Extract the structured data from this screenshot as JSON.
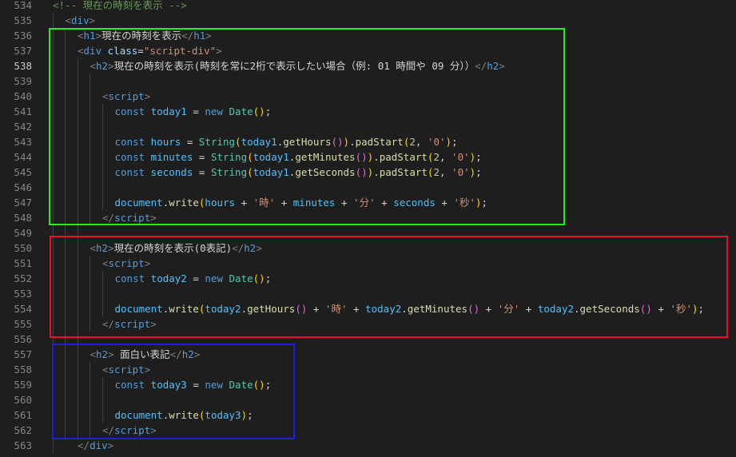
{
  "editor": {
    "active_line": "538",
    "highlight_colors": {
      "green_box": "#22ee22",
      "red_box": "#e8112d",
      "blue_box": "#1d1de0"
    },
    "lines": [
      {
        "n": "534",
        "indent": 0,
        "tokens": [
          [
            "cmt",
            "<!-- 現在の時刻を表示 -->"
          ]
        ]
      },
      {
        "n": "535",
        "indent": 1,
        "tokens": [
          [
            "br",
            "<"
          ],
          [
            "tag",
            "div"
          ],
          [
            "br",
            ">"
          ]
        ]
      },
      {
        "n": "536",
        "indent": 2,
        "tokens": [
          [
            "br",
            "<"
          ],
          [
            "tag",
            "h1"
          ],
          [
            "br",
            ">"
          ],
          [
            "txt",
            "現在の時刻を表示"
          ],
          [
            "br",
            "</"
          ],
          [
            "tag",
            "h1"
          ],
          [
            "br",
            ">"
          ]
        ]
      },
      {
        "n": "537",
        "indent": 2,
        "tokens": [
          [
            "br",
            "<"
          ],
          [
            "tag",
            "div"
          ],
          [
            "txt",
            " "
          ],
          [
            "attr",
            "class"
          ],
          [
            "op",
            "="
          ],
          [
            "str",
            "\"script-div\""
          ],
          [
            "br",
            ">"
          ]
        ]
      },
      {
        "n": "538",
        "indent": 3,
        "tokens": [
          [
            "br",
            "<"
          ],
          [
            "tag",
            "h2"
          ],
          [
            "br",
            ">"
          ],
          [
            "txt",
            "現在の時刻を表示(時刻を常に2桁で表示したい場合（例: 01 時間や 09 分））"
          ],
          [
            "br",
            "</"
          ],
          [
            "tag",
            "h2"
          ],
          [
            "br",
            ">"
          ]
        ]
      },
      {
        "n": "539",
        "indent": 0,
        "tokens": []
      },
      {
        "n": "540",
        "indent": 4,
        "tokens": [
          [
            "br",
            "<"
          ],
          [
            "tag",
            "script"
          ],
          [
            "br",
            ">"
          ]
        ]
      },
      {
        "n": "541",
        "indent": 5,
        "tokens": [
          [
            "kw",
            "const"
          ],
          [
            "txt",
            " "
          ],
          [
            "var",
            "today1"
          ],
          [
            "op",
            " = "
          ],
          [
            "kw",
            "new"
          ],
          [
            "txt",
            " "
          ],
          [
            "cls",
            "Date"
          ],
          [
            "p1",
            "()"
          ],
          [
            "op",
            ";"
          ]
        ]
      },
      {
        "n": "542",
        "indent": 0,
        "tokens": []
      },
      {
        "n": "543",
        "indent": 5,
        "tokens": [
          [
            "kw",
            "const"
          ],
          [
            "txt",
            " "
          ],
          [
            "var",
            "hours"
          ],
          [
            "op",
            " = "
          ],
          [
            "cls",
            "String"
          ],
          [
            "p1",
            "("
          ],
          [
            "var",
            "today1"
          ],
          [
            "op",
            "."
          ],
          [
            "fn",
            "getHours"
          ],
          [
            "p2",
            "()"
          ],
          [
            "p1",
            ")"
          ],
          [
            "op",
            "."
          ],
          [
            "fn",
            "padStart"
          ],
          [
            "p1",
            "("
          ],
          [
            "num",
            "2"
          ],
          [
            "op",
            ", "
          ],
          [
            "str",
            "'0'"
          ],
          [
            "p1",
            ")"
          ],
          [
            "op",
            ";"
          ]
        ]
      },
      {
        "n": "544",
        "indent": 5,
        "tokens": [
          [
            "kw",
            "const"
          ],
          [
            "txt",
            " "
          ],
          [
            "var",
            "minutes"
          ],
          [
            "op",
            " = "
          ],
          [
            "cls",
            "String"
          ],
          [
            "p1",
            "("
          ],
          [
            "var",
            "today1"
          ],
          [
            "op",
            "."
          ],
          [
            "fn",
            "getMinutes"
          ],
          [
            "p2",
            "()"
          ],
          [
            "p1",
            ")"
          ],
          [
            "op",
            "."
          ],
          [
            "fn",
            "padStart"
          ],
          [
            "p1",
            "("
          ],
          [
            "num",
            "2"
          ],
          [
            "op",
            ", "
          ],
          [
            "str",
            "'0'"
          ],
          [
            "p1",
            ")"
          ],
          [
            "op",
            ";"
          ]
        ]
      },
      {
        "n": "545",
        "indent": 5,
        "tokens": [
          [
            "kw",
            "const"
          ],
          [
            "txt",
            " "
          ],
          [
            "var",
            "seconds"
          ],
          [
            "op",
            " = "
          ],
          [
            "cls",
            "String"
          ],
          [
            "p1",
            "("
          ],
          [
            "var",
            "today1"
          ],
          [
            "op",
            "."
          ],
          [
            "fn",
            "getSeconds"
          ],
          [
            "p2",
            "()"
          ],
          [
            "p1",
            ")"
          ],
          [
            "op",
            "."
          ],
          [
            "fn",
            "padStart"
          ],
          [
            "p1",
            "("
          ],
          [
            "num",
            "2"
          ],
          [
            "op",
            ", "
          ],
          [
            "str",
            "'0'"
          ],
          [
            "p1",
            ")"
          ],
          [
            "op",
            ";"
          ]
        ]
      },
      {
        "n": "546",
        "indent": 0,
        "tokens": []
      },
      {
        "n": "547",
        "indent": 5,
        "tokens": [
          [
            "var",
            "document"
          ],
          [
            "op",
            "."
          ],
          [
            "fn",
            "write"
          ],
          [
            "p1",
            "("
          ],
          [
            "var",
            "hours"
          ],
          [
            "op",
            " + "
          ],
          [
            "str",
            "'時'"
          ],
          [
            "op",
            " + "
          ],
          [
            "var",
            "minutes"
          ],
          [
            "op",
            " + "
          ],
          [
            "str",
            "'分'"
          ],
          [
            "op",
            " + "
          ],
          [
            "var",
            "seconds"
          ],
          [
            "op",
            " + "
          ],
          [
            "str",
            "'秒'"
          ],
          [
            "p1",
            ")"
          ],
          [
            "op",
            ";"
          ]
        ]
      },
      {
        "n": "548",
        "indent": 4,
        "tokens": [
          [
            "br",
            "</"
          ],
          [
            "tag",
            "script"
          ],
          [
            "br",
            ">"
          ]
        ]
      },
      {
        "n": "549",
        "indent": 0,
        "tokens": []
      },
      {
        "n": "550",
        "indent": 3,
        "tokens": [
          [
            "br",
            "<"
          ],
          [
            "tag",
            "h2"
          ],
          [
            "br",
            ">"
          ],
          [
            "txt",
            "現在の時刻を表示(0表記)"
          ],
          [
            "br",
            "</"
          ],
          [
            "tag",
            "h2"
          ],
          [
            "br",
            ">"
          ]
        ]
      },
      {
        "n": "551",
        "indent": 4,
        "tokens": [
          [
            "br",
            "<"
          ],
          [
            "tag",
            "script"
          ],
          [
            "br",
            ">"
          ]
        ]
      },
      {
        "n": "552",
        "indent": 5,
        "tokens": [
          [
            "kw",
            "const"
          ],
          [
            "txt",
            " "
          ],
          [
            "var",
            "today2"
          ],
          [
            "op",
            " = "
          ],
          [
            "kw",
            "new"
          ],
          [
            "txt",
            " "
          ],
          [
            "cls",
            "Date"
          ],
          [
            "p1",
            "()"
          ],
          [
            "op",
            ";"
          ]
        ]
      },
      {
        "n": "553",
        "indent": 0,
        "tokens": []
      },
      {
        "n": "554",
        "indent": 5,
        "tokens": [
          [
            "var",
            "document"
          ],
          [
            "op",
            "."
          ],
          [
            "fn",
            "write"
          ],
          [
            "p1",
            "("
          ],
          [
            "var",
            "today2"
          ],
          [
            "op",
            "."
          ],
          [
            "fn",
            "getHours"
          ],
          [
            "p2",
            "()"
          ],
          [
            "op",
            " + "
          ],
          [
            "str",
            "'時'"
          ],
          [
            "op",
            " + "
          ],
          [
            "var",
            "today2"
          ],
          [
            "op",
            "."
          ],
          [
            "fn",
            "getMinutes"
          ],
          [
            "p2",
            "()"
          ],
          [
            "op",
            " + "
          ],
          [
            "str",
            "'分'"
          ],
          [
            "op",
            " + "
          ],
          [
            "var",
            "today2"
          ],
          [
            "op",
            "."
          ],
          [
            "fn",
            "getSeconds"
          ],
          [
            "p2",
            "()"
          ],
          [
            "op",
            " + "
          ],
          [
            "str",
            "'秒'"
          ],
          [
            "p1",
            ")"
          ],
          [
            "op",
            ";"
          ]
        ]
      },
      {
        "n": "555",
        "indent": 4,
        "tokens": [
          [
            "br",
            "</"
          ],
          [
            "tag",
            "script"
          ],
          [
            "br",
            ">"
          ]
        ]
      },
      {
        "n": "556",
        "indent": 0,
        "tokens": []
      },
      {
        "n": "557",
        "indent": 3,
        "tokens": [
          [
            "br",
            "<"
          ],
          [
            "tag",
            "h2"
          ],
          [
            "br",
            ">"
          ],
          [
            "txt",
            " 面白い表記"
          ],
          [
            "br",
            "</"
          ],
          [
            "tag",
            "h2"
          ],
          [
            "br",
            ">"
          ]
        ]
      },
      {
        "n": "558",
        "indent": 4,
        "tokens": [
          [
            "br",
            "<"
          ],
          [
            "tag",
            "script"
          ],
          [
            "br",
            ">"
          ]
        ]
      },
      {
        "n": "559",
        "indent": 5,
        "tokens": [
          [
            "kw",
            "const"
          ],
          [
            "txt",
            " "
          ],
          [
            "var",
            "today3"
          ],
          [
            "op",
            " = "
          ],
          [
            "kw",
            "new"
          ],
          [
            "txt",
            " "
          ],
          [
            "cls",
            "Date"
          ],
          [
            "p1",
            "()"
          ],
          [
            "op",
            ";"
          ]
        ]
      },
      {
        "n": "560",
        "indent": 0,
        "tokens": []
      },
      {
        "n": "561",
        "indent": 5,
        "tokens": [
          [
            "var",
            "document"
          ],
          [
            "op",
            "."
          ],
          [
            "fn",
            "write"
          ],
          [
            "p1",
            "("
          ],
          [
            "var",
            "today3"
          ],
          [
            "p1",
            ")"
          ],
          [
            "op",
            ";"
          ]
        ]
      },
      {
        "n": "562",
        "indent": 4,
        "tokens": [
          [
            "br",
            "</"
          ],
          [
            "tag",
            "script"
          ],
          [
            "br",
            ">"
          ]
        ]
      },
      {
        "n": "563",
        "indent": 2,
        "tokens": [
          [
            "br",
            "</"
          ],
          [
            "tag",
            "div"
          ],
          [
            "br",
            ">"
          ]
        ]
      }
    ]
  }
}
